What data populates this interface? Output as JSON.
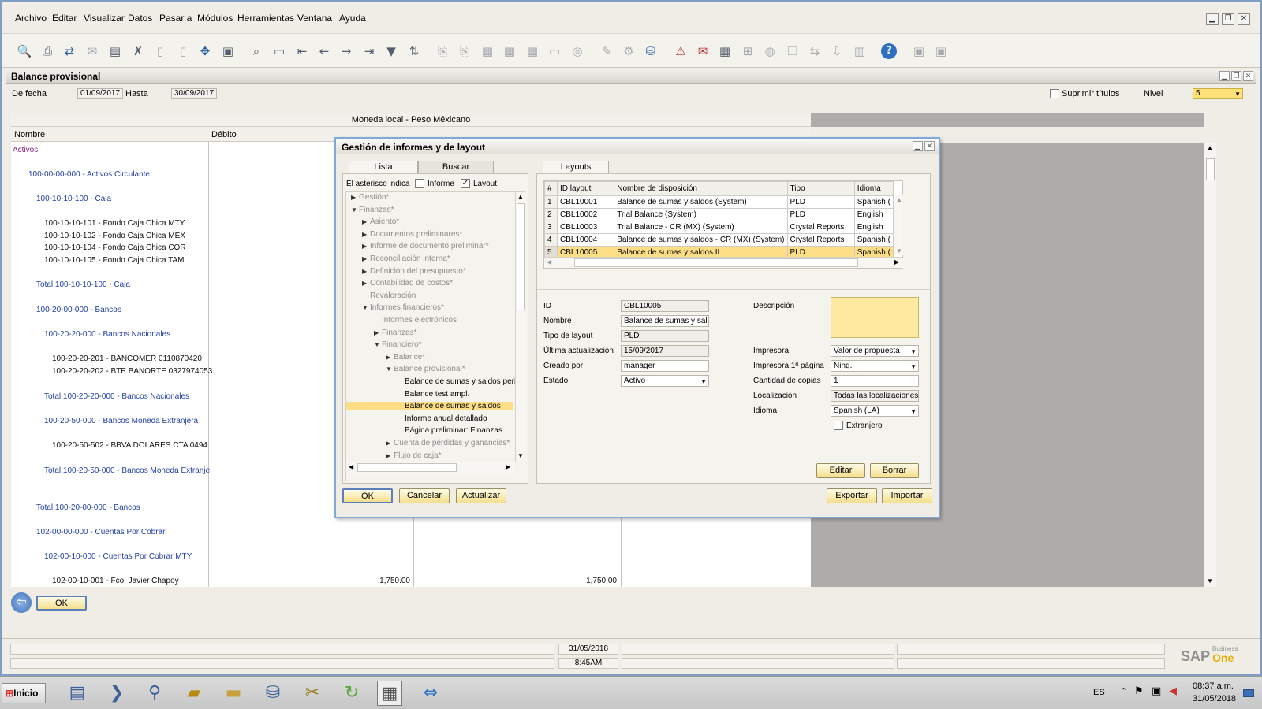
{
  "menu": [
    "Archivo",
    "Editar",
    "Visualizar",
    "Datos",
    "Pasar a",
    "Módulos",
    "Herramientas",
    "Ventana",
    "Ayuda"
  ],
  "report": {
    "title": "Balance provisional",
    "from_label": "De fecha",
    "from_value": "01/09/2017",
    "to_label": "Hasta",
    "to_value": "30/09/2017",
    "suppress_label": "Suprimir títulos",
    "level_label": "Nivel",
    "level_value": "5",
    "currency_header": "Moneda local - Peso Méxicano",
    "col_name": "Nombre",
    "col_debit": "Débito",
    "ok_label": "OK",
    "rows": [
      {
        "text": "Activos",
        "color": "purple",
        "indent": 0
      },
      {
        "text": "100-00-00-000 - Activos Circulante",
        "color": "blue",
        "indent": 1
      },
      {
        "text": "100-10-10-100 - Caja",
        "color": "blue",
        "indent": 2
      },
      {
        "text": "100-10-10-101 - Fondo Caja Chica MTY",
        "color": "black",
        "indent": 3
      },
      {
        "text": "100-10-10-102 - Fondo Caja Chica MEX",
        "color": "black",
        "indent": 3
      },
      {
        "text": "100-10-10-104 - Fondo Caja Chica COR",
        "color": "black",
        "indent": 3
      },
      {
        "text": "100-10-10-105 - Fondo Caja Chica TAM",
        "color": "black",
        "indent": 3
      },
      {
        "text": "Total 100-10-10-100 - Caja",
        "color": "blue",
        "indent": 2
      },
      {
        "text": "100-20-00-000 - Bancos",
        "color": "blue",
        "indent": 2
      },
      {
        "text": "100-20-20-000 - Bancos Nacionales",
        "color": "blue",
        "indent": 3
      },
      {
        "text": "100-20-20-201 - BANCOMER  0110870420",
        "color": "black",
        "indent": 4
      },
      {
        "text": "100-20-20-202 - BTE BANORTE 0327974053",
        "color": "black",
        "indent": 4
      },
      {
        "text": "Total 100-20-20-000 - Bancos Nacionales",
        "color": "blue",
        "indent": 3
      },
      {
        "text": "100-20-50-000 - Bancos Moneda Extranjera",
        "color": "blue",
        "indent": 3
      },
      {
        "text": "100-20-50-502 - BBVA DOLARES CTA 0494",
        "color": "black",
        "indent": 4
      },
      {
        "text": "Total 100-20-50-000 - Bancos Moneda Extranje",
        "color": "blue",
        "indent": 3
      },
      {
        "text": "Total 100-20-00-000 - Bancos",
        "color": "blue",
        "indent": 2
      },
      {
        "text": "102-00-00-000 - Cuentas Por Cobrar",
        "color": "blue",
        "indent": 2
      },
      {
        "text": "102-00-10-000 - Cuentas Por Cobrar MTY",
        "color": "blue",
        "indent": 3
      },
      {
        "text": "102-00-10-001 - Fco. Javier Chapoy",
        "color": "black",
        "indent": 4
      }
    ],
    "last_debit": "1,750.00",
    "last_credit": "1,750.00"
  },
  "dialog": {
    "title": "Gestión de informes y de layout",
    "tab_list": "Lista",
    "tab_search": "Buscar",
    "tab_layouts": "Layouts",
    "asterisk_label": "El asterisco indica",
    "informe_label": "Informe",
    "layout_label": "Layout",
    "tree": [
      {
        "text": "Gestión*",
        "level": 0,
        "arrow": "right",
        "dim": true
      },
      {
        "text": "Finanzas*",
        "level": 0,
        "arrow": "down",
        "dim": true
      },
      {
        "text": "Asiento*",
        "level": 1,
        "arrow": "right",
        "dim": true
      },
      {
        "text": "Documentos preliminares*",
        "level": 1,
        "arrow": "right",
        "dim": true
      },
      {
        "text": "Informe de documento preliminar*",
        "level": 1,
        "arrow": "right",
        "dim": true
      },
      {
        "text": "Reconciliación interna*",
        "level": 1,
        "arrow": "right",
        "dim": true
      },
      {
        "text": "Definición del presupuesto*",
        "level": 1,
        "arrow": "right",
        "dim": true
      },
      {
        "text": "Contabilidad de costos*",
        "level": 1,
        "arrow": "right",
        "dim": true
      },
      {
        "text": "Revaloración",
        "level": 1,
        "arrow": "",
        "dim": true
      },
      {
        "text": "Informes financieros*",
        "level": 1,
        "arrow": "down",
        "dim": true
      },
      {
        "text": "Informes electrónicos",
        "level": 2,
        "arrow": "",
        "dim": true
      },
      {
        "text": "Finanzas*",
        "level": 2,
        "arrow": "right",
        "dim": true
      },
      {
        "text": "Financiero*",
        "level": 2,
        "arrow": "down",
        "dim": true
      },
      {
        "text": "Balance*",
        "level": 3,
        "arrow": "right",
        "dim": true
      },
      {
        "text": "Balance provisional*",
        "level": 3,
        "arrow": "down",
        "dim": true
      },
      {
        "text": "Balance de sumas y saldos peric",
        "level": 4,
        "arrow": "",
        "dim": false
      },
      {
        "text": "Balance test ampl.",
        "level": 4,
        "arrow": "",
        "dim": false
      },
      {
        "text": "Balance de sumas y saldos",
        "level": 4,
        "arrow": "",
        "dim": false,
        "selected": true
      },
      {
        "text": "Informe anual detallado",
        "level": 4,
        "arrow": "",
        "dim": false
      },
      {
        "text": "Página preliminar: Finanzas",
        "level": 4,
        "arrow": "",
        "dim": false
      },
      {
        "text": "Cuenta de pérdidas y ganancias*",
        "level": 3,
        "arrow": "right",
        "dim": true
      },
      {
        "text": "Flujo de caja*",
        "level": 3,
        "arrow": "right",
        "dim": true
      }
    ],
    "table_headers": [
      "#",
      "ID layout",
      "Nombre de disposición",
      "Tipo",
      "Idioma"
    ],
    "layouts": [
      {
        "n": "1",
        "id": "CBL10001",
        "name": "Balance de sumas y saldos (System)",
        "type": "PLD",
        "lang": "Spanish ("
      },
      {
        "n": "2",
        "id": "CBL10002",
        "name": "Trial Balance (System)",
        "type": "PLD",
        "lang": "English"
      },
      {
        "n": "3",
        "id": "CBL10003",
        "name": "Trial Balance - CR (MX) (System)",
        "type": "Crystal Reports",
        "lang": "English"
      },
      {
        "n": "4",
        "id": "CBL10004",
        "name": "Balance de sumas y saldos - CR (MX) (System)",
        "type": "Crystal Reports",
        "lang": "Spanish ("
      },
      {
        "n": "5",
        "id": "CBL10005",
        "name": "Balance de sumas y saldos II",
        "type": "PLD",
        "lang": "Spanish (",
        "selected": true
      }
    ],
    "details": {
      "id_label": "ID",
      "id_value": "CBL10005",
      "name_label": "Nombre",
      "name_value": "Balance de sumas y saldo",
      "type_label": "Tipo de layout",
      "type_value": "PLD",
      "updated_label": "Última actualización",
      "updated_value": "15/09/2017",
      "created_label": "Creado por",
      "created_value": "manager",
      "state_label": "Estado",
      "state_value": "Activo",
      "desc_label": "Descripción",
      "printer_label": "Impresora",
      "printer_value": "Valor de propuesta",
      "printer1_label": "Impresora 1ª página",
      "printer1_value": "Ning.",
      "copies_label": "Cantidad de copias",
      "copies_value": "1",
      "loc_label": "Localización",
      "loc_value": "Todas las localizaciones",
      "lang_label": "Idioma",
      "lang_value": "Spanish (LA)",
      "foreign_label": "Extranjero"
    },
    "btn_edit": "Editar",
    "btn_delete": "Borrar",
    "btn_ok": "OK",
    "btn_cancel": "Cancelar",
    "btn_update": "Actualizar",
    "btn_export": "Exportar",
    "btn_import": "Importar"
  },
  "status": {
    "date": "31/05/2018",
    "time": "8:45AM",
    "brand_sap": "SAP",
    "brand_business": "Business",
    "brand_one": "One"
  },
  "taskbar": {
    "start_label": "Inicio",
    "lang": "ES",
    "clock_time": "08:37 a.m.",
    "clock_date": "31/05/2018"
  }
}
